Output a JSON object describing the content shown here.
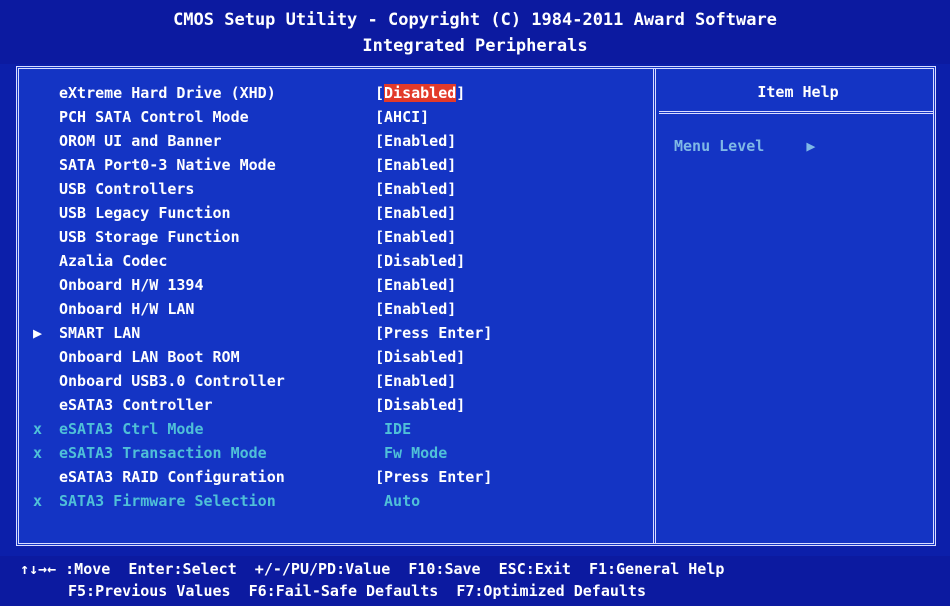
{
  "header": {
    "title": "CMOS Setup Utility - Copyright (C) 1984-2011 Award Software",
    "subtitle": "Integrated Peripherals"
  },
  "help_panel": {
    "title": "Item Help",
    "menu_level": "Menu Level",
    "menu_level_arrow": "▶"
  },
  "rows": [
    {
      "label": "eXtreme Hard Drive (XHD)",
      "open": "[",
      "value": "Disabled",
      "close": "]",
      "selected": true
    },
    {
      "label": "PCH SATA Control Mode",
      "value": "[AHCI]"
    },
    {
      "label": "OROM UI and Banner",
      "value": "[Enabled]"
    },
    {
      "label": "SATA Port0-3 Native Mode",
      "value": "[Enabled]"
    },
    {
      "label": "USB Controllers",
      "value": "[Enabled]"
    },
    {
      "label": "USB Legacy Function",
      "value": "[Enabled]"
    },
    {
      "label": "USB Storage Function",
      "value": "[Enabled]"
    },
    {
      "label": "Azalia Codec",
      "value": "[Disabled]"
    },
    {
      "label": "Onboard H/W 1394",
      "value": "[Enabled]"
    },
    {
      "label": "Onboard H/W LAN",
      "value": "[Enabled]"
    },
    {
      "label": "SMART LAN",
      "value": "[Press Enter]",
      "marker": "▶"
    },
    {
      "label": "Onboard LAN Boot ROM",
      "value": "[Disabled]"
    },
    {
      "label": "Onboard USB3.0 Controller",
      "value": "[Enabled]"
    },
    {
      "label": "eSATA3 Controller",
      "value": "[Disabled]"
    },
    {
      "label": "eSATA3 Ctrl Mode",
      "value": " IDE",
      "marker": "x",
      "disabled": true
    },
    {
      "label": "eSATA3 Transaction Mode",
      "value": " Fw Mode",
      "marker": "x",
      "disabled": true
    },
    {
      "label": "eSATA3 RAID Configuration",
      "value": "[Press Enter]"
    },
    {
      "label": "SATA3 Firmware Selection",
      "value": " Auto",
      "marker": "x",
      "disabled": true
    }
  ],
  "footer": {
    "line1": "↑↓→← :Move  Enter:Select  +/-/PU/PD:Value  F10:Save  ESC:Exit  F1:General Help",
    "line2": "F5:Previous Values  F6:Fail-Safe Defaults  F7:Optimized Defaults"
  },
  "colors": {
    "background": "#1434c4",
    "highlight": "#e23a2a",
    "disabled_text": "#4fc0d8"
  }
}
